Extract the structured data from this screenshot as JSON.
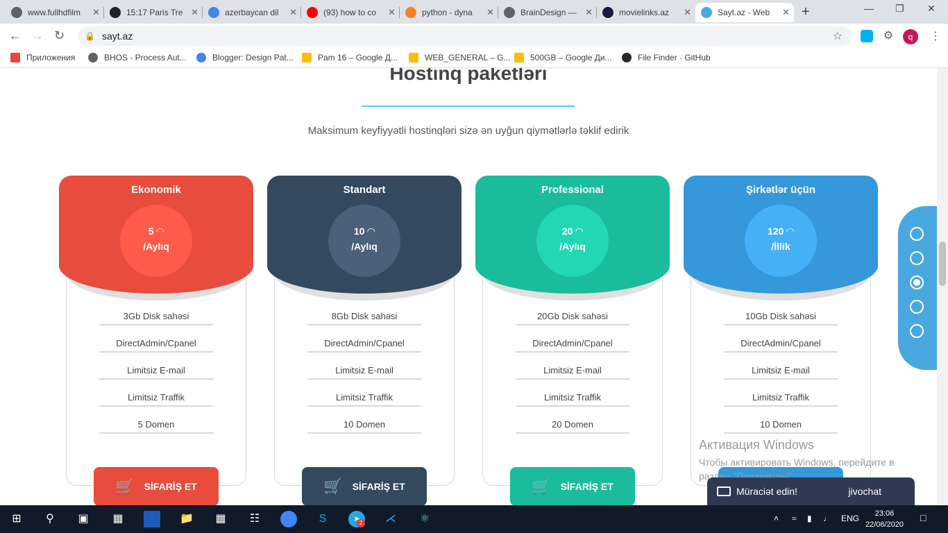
{
  "browser": {
    "tabs": [
      {
        "label": "www.fullhdfilm",
        "icon": "globe-icon",
        "color": "#5f6368"
      },
      {
        "label": "15:17 Paris Tre",
        "icon": "film-icon",
        "color": "#202124"
      },
      {
        "label": "azerbaycan dil",
        "icon": "google-icon",
        "color": "#4285f4"
      },
      {
        "label": "(93) how to co",
        "icon": "youtube-icon",
        "color": "#ff0000"
      },
      {
        "label": "python - dyna",
        "icon": "stackoverflow-icon",
        "color": "#f48024"
      },
      {
        "label": "BrainDesign —",
        "icon": "globe-icon",
        "color": "#5f6368"
      },
      {
        "label": "movielinks.az",
        "icon": "movielinks-icon",
        "color": "#1a1a40"
      },
      {
        "label": "Sayt.az - Web",
        "icon": "sayt-icon",
        "color": "#4aa8e0"
      }
    ],
    "url": "sayt.az",
    "avatar_letter": "q"
  },
  "bookmarks": [
    {
      "label": "Приложения",
      "icon": "apps-icon"
    },
    {
      "label": "BHOS - Process Aut...",
      "icon": "globe-icon"
    },
    {
      "label": "Blogger: Design Pat...",
      "icon": "google-icon"
    },
    {
      "label": "Pam 16 – Google Д...",
      "icon": "drive-icon"
    },
    {
      "label": "WEB_GENERAL – G...",
      "icon": "drive-icon"
    },
    {
      "label": "500GB – Google Ди...",
      "icon": "drive-icon"
    },
    {
      "label": "File Finder · GitHub",
      "icon": "github-icon"
    }
  ],
  "section": {
    "title": "Hostinq paketləri",
    "subtitle": "Maksimum keyfiyyətli hostinqləri sizə ən uyğun qiymətlərlə təklif edirik"
  },
  "plans": [
    {
      "name": "Ekonomik",
      "price": "5",
      "period": "/Aylıq",
      "color": "#e74c3c",
      "circle": "#ff5b4a",
      "features": [
        "3Gb Disk sahəsi",
        "DirectAdmin/Cpanel",
        "Limitsiz E-mail",
        "Limitsiz Traffik",
        "5 Domen"
      ],
      "order": "SİFARİŞ ET"
    },
    {
      "name": "Standart",
      "price": "10",
      "period": "/Aylıq",
      "color": "#34495e",
      "circle": "#4a6178",
      "features": [
        "8Gb Disk sahəsi",
        "DirectAdmin/Cpanel",
        "Limitsiz E-mail",
        "Limitsiz Traffik",
        "10 Domen"
      ],
      "order": "SİFARİŞ ET"
    },
    {
      "name": "Professional",
      "price": "20",
      "period": "/Aylıq",
      "color": "#1abc9c",
      "circle": "#22d8b4",
      "features": [
        "20Gb Disk sahəsi",
        "DirectAdmin/Cpanel",
        "Limitsiz E-mail",
        "Limitsiz Traffik",
        "20 Domen"
      ],
      "order": "SİFARİŞ ET"
    },
    {
      "name": "Şirkətlər üçün",
      "price": "120",
      "period": "/İllik",
      "color": "#3498db",
      "circle": "#45b0f5",
      "features": [
        "10Gb Disk sahəsi",
        "DirectAdmin/Cpanel",
        "Limitsiz E-mail",
        "Limitsiz Traffik",
        "10 Domen"
      ],
      "order": ""
    }
  ],
  "sidenav": {
    "count": 5,
    "active_index": 2
  },
  "windows_activation": {
    "title": "Активация Windows",
    "text": "Чтобы активировать Windows, перейдите в раздел \"Параметры\"."
  },
  "chat": {
    "label": "Müraciət edin!",
    "brand": "jivochat"
  },
  "taskbar": {
    "lang": "ENG",
    "time": "23:06",
    "date": "22/06/2020",
    "telegram_badge": "2"
  }
}
